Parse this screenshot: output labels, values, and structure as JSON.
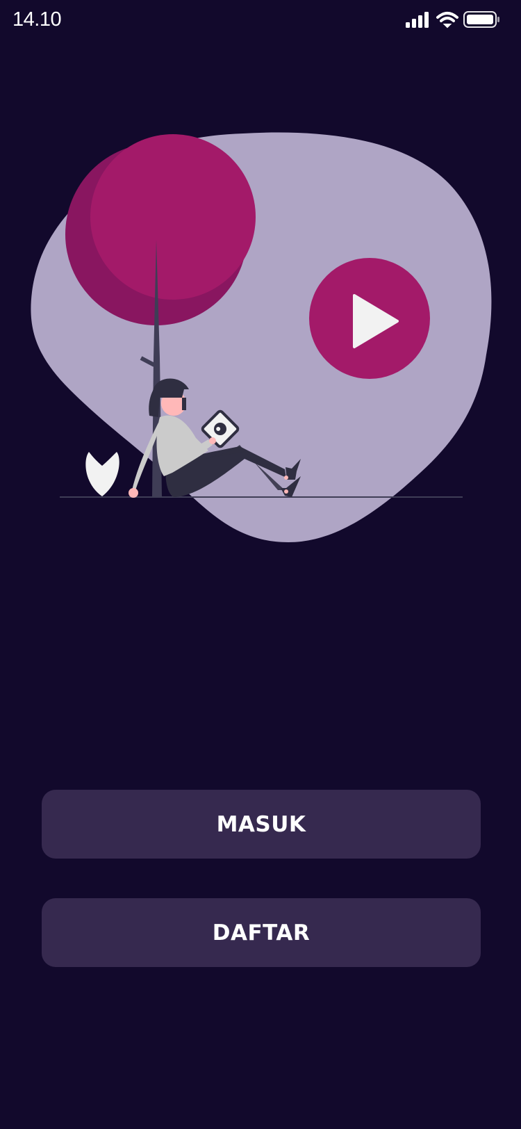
{
  "status_bar": {
    "time": "14.10",
    "icons": [
      "signal-icon",
      "wifi-icon",
      "battery-icon"
    ]
  },
  "illustration": {
    "description_icons": [
      "play-icon",
      "tree",
      "person-reading",
      "leaf"
    ],
    "colors": {
      "blob": "#afa5c5",
      "tree_canopy": "#a31a69",
      "tree_canopy_shade": "#891660",
      "play_circle": "#a31a69",
      "play_triangle": "#f2f2f2"
    }
  },
  "actions": {
    "login_label": "MASUK",
    "register_label": "DAFTAR"
  },
  "colors": {
    "background": "#12092c",
    "button": "#36294f",
    "button_text": "#ffffff"
  }
}
